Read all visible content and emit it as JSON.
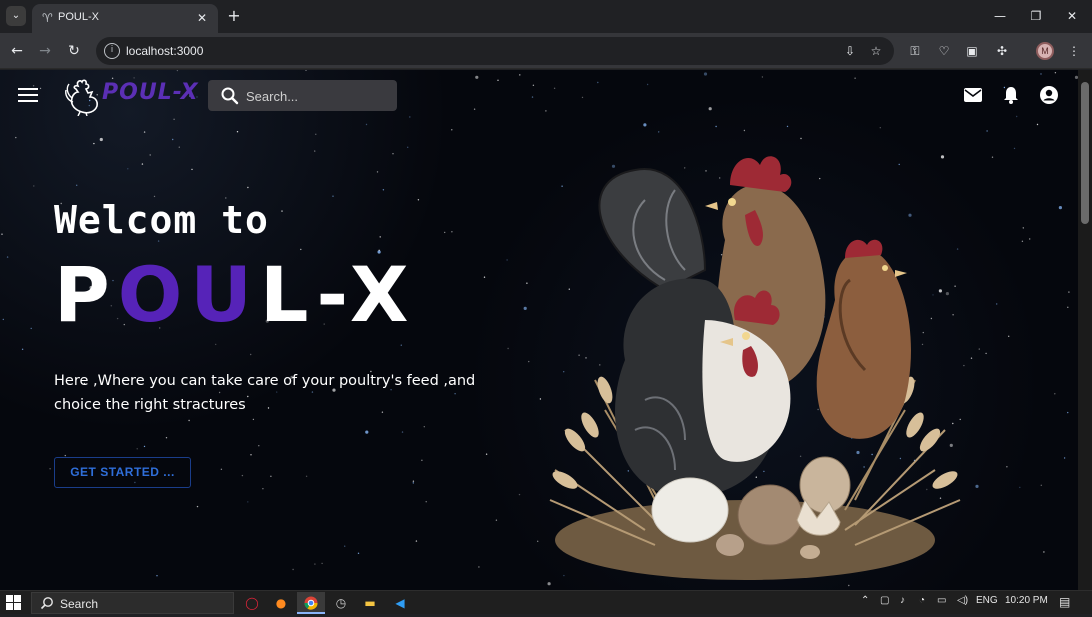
{
  "browser": {
    "tab_title": "POUL-X",
    "url": "localhost:3000",
    "profile_initial": "M"
  },
  "app": {
    "logo_text": "POUL-X",
    "search_placeholder": "Search..."
  },
  "hero": {
    "heading_line1": "Welcom to",
    "brand_parts": [
      "P",
      "OU",
      "L",
      "-X"
    ],
    "subtitle": "Here ,Where you can take care of your poultry's feed ,and choice the right stractures",
    "cta_label": "GET STARTED ..."
  },
  "taskbar": {
    "search_label": "Search",
    "language": "ENG",
    "time": "10:20 PM"
  },
  "colors": {
    "brand_purple": "#5623b8",
    "cta_blue": "#2f6ed9",
    "page_background": "#05070d"
  },
  "icons": [
    "menu-icon",
    "rooster-logo-icon",
    "search-icon",
    "mail-icon",
    "bell-icon",
    "account-circle-icon",
    "windows-start-icon",
    "opera-icon",
    "firefox-icon",
    "chrome-icon",
    "clock-icon",
    "file-explorer-icon",
    "vscode-icon"
  ]
}
